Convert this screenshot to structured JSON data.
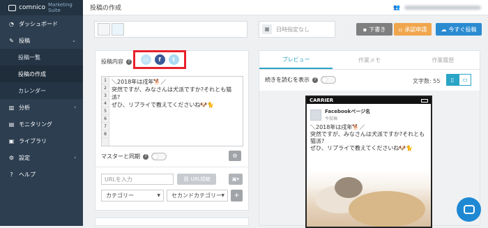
{
  "sidebar": {
    "logo": {
      "name": "comnico",
      "suite": "Marketing Suite"
    },
    "items": [
      {
        "label": "ダッシュボード",
        "icon": "dashboard-icon"
      },
      {
        "label": "投稿",
        "icon": "pencil-icon"
      },
      {
        "label": "投稿一覧"
      },
      {
        "label": "投稿の作成"
      },
      {
        "label": "カレンダー"
      },
      {
        "label": "分析",
        "icon": "chart-icon"
      },
      {
        "label": "モニタリング",
        "icon": "monitor-icon"
      },
      {
        "label": "ライブラリ",
        "icon": "library-icon"
      },
      {
        "label": "設定",
        "icon": "gear-icon"
      },
      {
        "label": "ヘルプ",
        "icon": "help-icon"
      }
    ]
  },
  "header": {
    "title": "投稿の作成"
  },
  "toolbar": {
    "schedule_placeholder": "日時指定なし",
    "draft_label": "下書き",
    "approve_label": "承認申請",
    "post_now_label": "今すぐ投稿"
  },
  "compose": {
    "content_label": "投稿内容",
    "editor_lines": [
      "＼2018年は戌年🐕／",
      "突然ですが、みなさんは犬派ですか?それとも猫",
      "派?",
      "ぜひ、リプライで教えてくださいね🐶🐈",
      "",
      "",
      "",
      ""
    ],
    "line_numbers": [
      "1",
      "2",
      "3",
      "4",
      "5",
      "6",
      "7",
      "8"
    ],
    "master_sync_label": "マスターと同期",
    "url_placeholder": "URLを入力",
    "url_shorten_label": "URL短縮",
    "category_label": "カテゴリー",
    "second_category_label": "セカンドカテゴリー",
    "plus_label": "+"
  },
  "preview": {
    "tabs": [
      "プレビュー",
      "作業メモ",
      "作業履歴"
    ],
    "read_more_label": "続きを読むを表示",
    "char_count_label": "文字数: 55",
    "carrier": "CARRIER",
    "page_name": "Facebookページ名",
    "page_sub": "今投稿",
    "post_lines": [
      "＼2018年は戌年🐕／",
      "突然ですが、みなさんは犬派ですか?それとも",
      "猫派?",
      "ぜひ、リプライで教えてくださいね🐶🐈"
    ]
  }
}
